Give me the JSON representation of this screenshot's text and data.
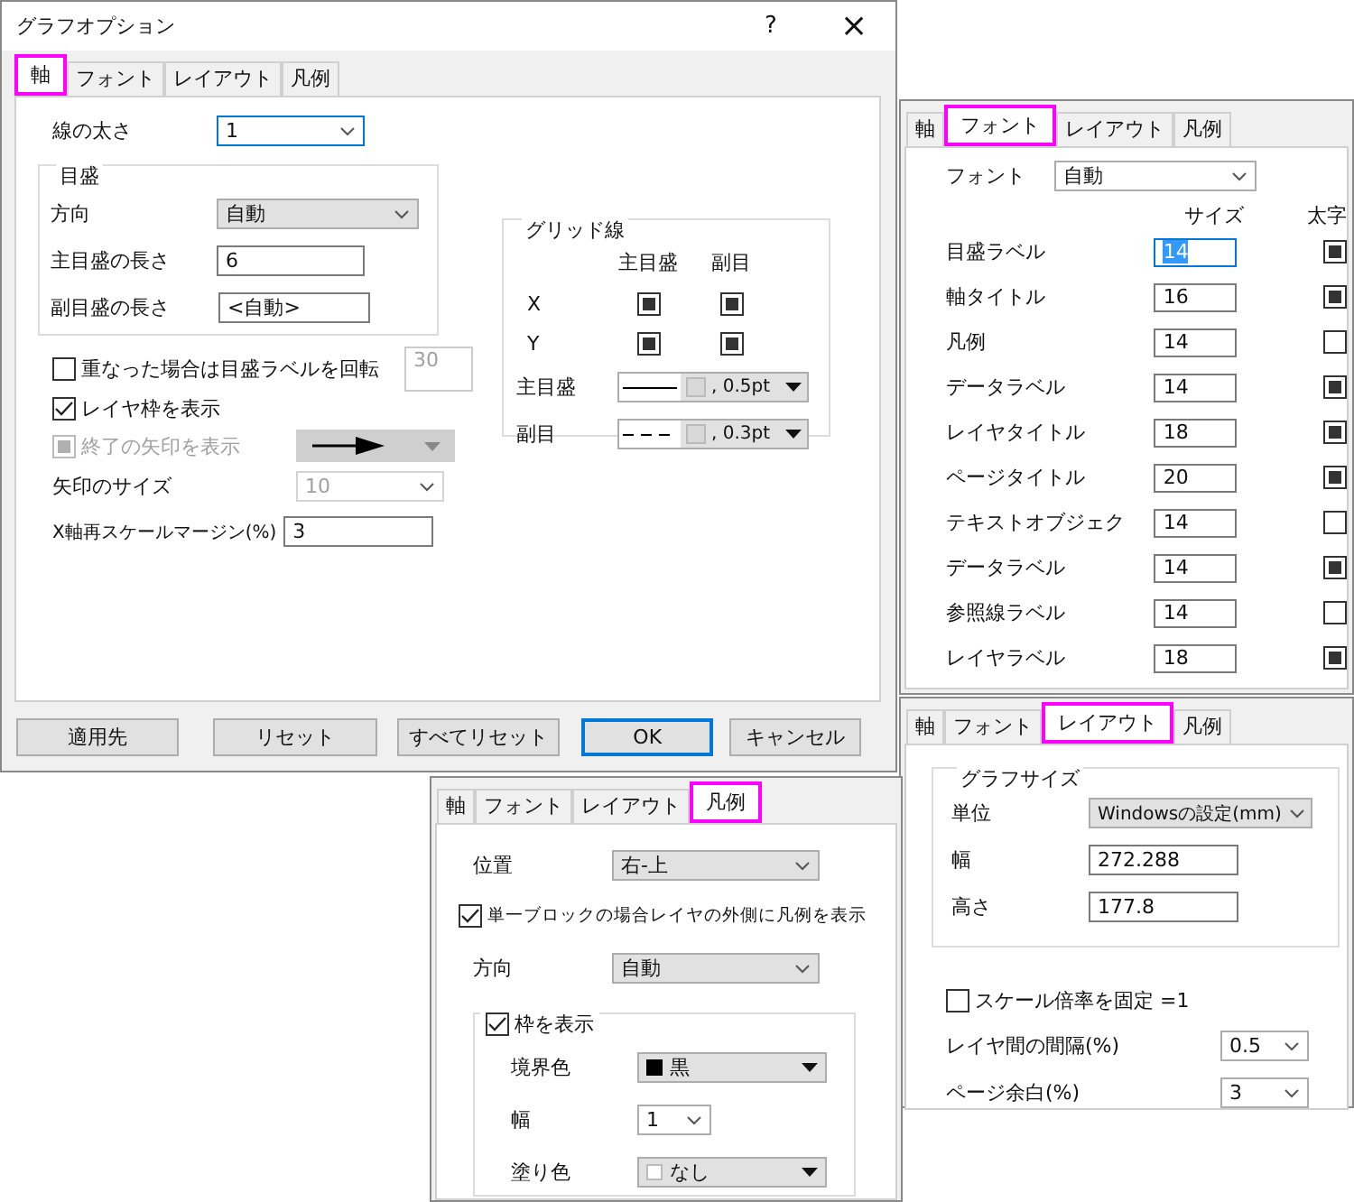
{
  "main_dialog": {
    "title": "グラフオプション",
    "help": "?",
    "close": "×",
    "tabs": [
      {
        "label": "軸",
        "selected": true
      },
      {
        "label": "フォント",
        "selected": false
      },
      {
        "label": "レイアウト",
        "selected": false
      },
      {
        "label": "凡例",
        "selected": false
      }
    ],
    "line_width": {
      "label": "線の太さ",
      "value": "1"
    },
    "ticks": {
      "title": "目盛",
      "direction": {
        "label": "方向",
        "value": "自動"
      },
      "major_length": {
        "label": "主目盛の長さ",
        "value": "6"
      },
      "minor_length": {
        "label": "副目盛の長さ",
        "value": "<自動>"
      }
    },
    "grid": {
      "title": "グリッド線",
      "major_header": "主目盛",
      "minor_header": "副目",
      "rows": [
        {
          "label": "X",
          "major": true,
          "minor": true
        },
        {
          "label": "Y",
          "major": true,
          "minor": true
        }
      ],
      "styles": [
        {
          "label": "主目盛",
          "dashed": false,
          "width": ", 0.5pt"
        },
        {
          "label": "副目",
          "dashed": true,
          "width": ", 0.3pt"
        }
      ]
    },
    "rotate_labels": {
      "label": "重なった場合は目盛ラベルを回転",
      "checked": false,
      "angle": "30"
    },
    "show_frame": {
      "label": "レイヤ枠を表示",
      "checked": true
    },
    "end_arrow": {
      "label": "終了の矢印を表示",
      "checked": true,
      "disabled": true
    },
    "arrow_size": {
      "label": "矢印のサイズ",
      "value": "10",
      "disabled": true
    },
    "rescale_margin": {
      "label": "X軸再スケールマージン(%)",
      "value": "3"
    },
    "buttons": [
      {
        "label": "適用先",
        "default": false
      },
      {
        "label": "リセット",
        "default": false
      },
      {
        "label": "すべてリセット",
        "default": false
      },
      {
        "label": "OK",
        "default": true
      },
      {
        "label": "キャンセル",
        "default": false
      }
    ]
  },
  "font_panel": {
    "tabs": [
      {
        "label": "軸",
        "selected": false
      },
      {
        "label": "フォント",
        "selected": true
      },
      {
        "label": "レイアウト",
        "selected": false
      },
      {
        "label": "凡例",
        "selected": false
      }
    ],
    "font": {
      "label": "フォント",
      "value": "自動"
    },
    "size_header": "サイズ",
    "bold_header": "太字",
    "rows": [
      {
        "label": "目盛ラベル",
        "size": "14",
        "bold": true,
        "focused": true
      },
      {
        "label": "軸タイトル",
        "size": "16",
        "bold": true,
        "focused": false
      },
      {
        "label": "凡例",
        "size": "14",
        "bold": false,
        "focused": false
      },
      {
        "label": "データラベル",
        "size": "14",
        "bold": true,
        "focused": false
      },
      {
        "label": "レイヤタイトル",
        "size": "18",
        "bold": true,
        "focused": false
      },
      {
        "label": "ページタイトル",
        "size": "20",
        "bold": true,
        "focused": false
      },
      {
        "label": "テキストオブジェク",
        "size": "14",
        "bold": false,
        "focused": false
      },
      {
        "label": "データラベル",
        "size": "14",
        "bold": true,
        "focused": false
      },
      {
        "label": "参照線ラベル",
        "size": "14",
        "bold": false,
        "focused": false
      },
      {
        "label": "レイヤラベル",
        "size": "18",
        "bold": true,
        "focused": false
      }
    ]
  },
  "layout_panel": {
    "tabs": [
      {
        "label": "軸",
        "selected": false
      },
      {
        "label": "フォント",
        "selected": false
      },
      {
        "label": "レイアウト",
        "selected": true
      },
      {
        "label": "凡例",
        "selected": false
      }
    ],
    "graph_size": {
      "title": "グラフサイズ",
      "unit": {
        "label": "単位",
        "value": "Windowsの設定(mm)"
      },
      "width": {
        "label": "幅",
        "value": "272.288"
      },
      "height": {
        "label": "高さ",
        "value": "177.8"
      }
    },
    "fix_scale": {
      "label": "スケール倍率を固定 =1",
      "checked": false
    },
    "layer_gap": {
      "label": "レイヤ間の間隔(%)",
      "value": "0.5"
    },
    "page_margin": {
      "label": "ページ余白(%)",
      "value": "3"
    }
  },
  "legend_panel": {
    "tabs": [
      {
        "label": "軸",
        "selected": false
      },
      {
        "label": "フォント",
        "selected": false
      },
      {
        "label": "レイアウト",
        "selected": false
      },
      {
        "label": "凡例",
        "selected": true
      }
    ],
    "position": {
      "label": "位置",
      "value": "右-上"
    },
    "outside": {
      "label": "単一ブロックの場合レイヤの外側に凡例を表示",
      "checked": true
    },
    "direction": {
      "label": "方向",
      "value": "自動"
    },
    "frame": {
      "label": "枠を表示",
      "checked": true,
      "border_color": {
        "label": "境界色",
        "value": "黒"
      },
      "width": {
        "label": "幅",
        "value": "1"
      },
      "fill_color": {
        "label": "塗り色",
        "value": "なし"
      }
    }
  }
}
